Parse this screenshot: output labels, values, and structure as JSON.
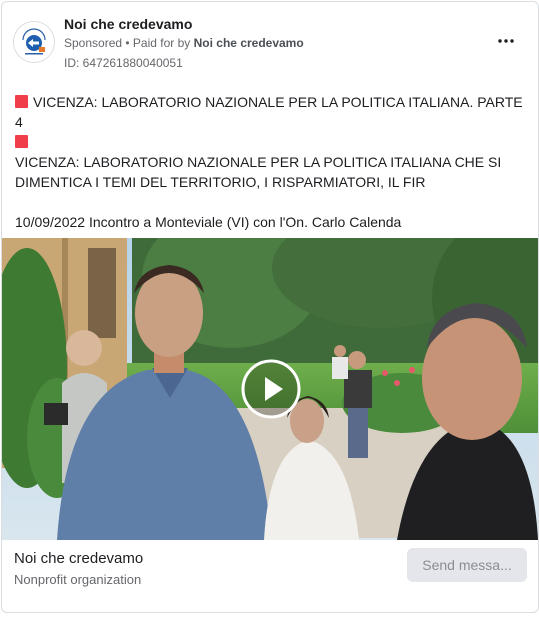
{
  "ad": {
    "page_name": "Noi che credevamo",
    "sponsored": "Sponsored",
    "paid_prefix": "• Paid for by",
    "paid_by": "Noi che credevamo",
    "library_id": "ID: 647261880040051",
    "more_icon": "more-horizontal-icon",
    "accent_color": "#f03e4a"
  },
  "body": {
    "line1": "VICENZA: LABORATORIO NAZIONALE PER LA POLITICA ITALIANA. PARTE 4",
    "line2": "VICENZA: LABORATORIO NAZIONALE PER LA POLITICA ITALIANA CHE SI DIMENTICA I TEMI DEL TERRITORIO, I RISPARMIATORI, IL FIR",
    "line3": "10/09/2022 Incontro a Monteviale (VI) con l'On. Carlo Calenda",
    "ellipsis": "..."
  },
  "media": {
    "type": "video",
    "play_icon": "play-icon"
  },
  "footer": {
    "title": "Noi che credevamo",
    "subtitle": "Nonprofit organization",
    "cta_label": "Send messa..."
  }
}
